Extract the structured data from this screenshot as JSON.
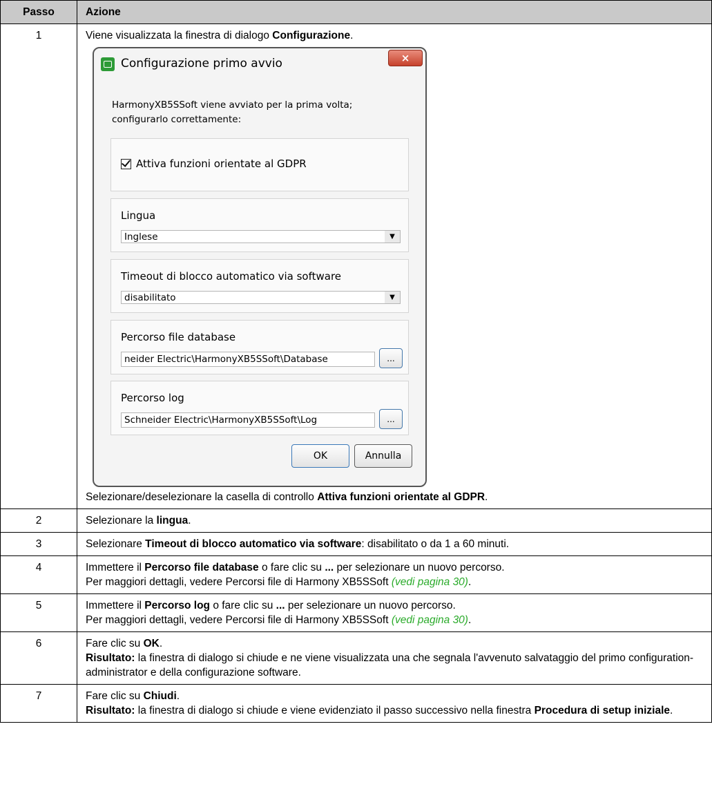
{
  "table": {
    "header_step": "Passo",
    "header_action": "Azione"
  },
  "step1": {
    "num": "1",
    "intro_pre": "Viene visualizzata la finestra di dialogo ",
    "intro_bold": "Configurazione",
    "intro_post": ".",
    "after_pre": "Selezionare/deselezionare la casella di controllo ",
    "after_bold": "Attiva funzioni orientate al GDPR",
    "after_post": "."
  },
  "dialog": {
    "title": "Configurazione primo avvio",
    "close_label": "×",
    "intro_line1": "HarmonyXB5SSoft viene avviato per la prima volta;",
    "intro_line2": "configurarlo correttamente:",
    "gdpr_label": "Attiva funzioni orientate al GDPR",
    "gdpr_checked": true,
    "language_label": "Lingua",
    "language_value": "Inglese",
    "timeout_label": "Timeout di blocco automatico via software",
    "timeout_value": "disabilitato",
    "db_path_label": "Percorso file database",
    "db_path_value": "neider Electric\\HarmonyXB5SSoft\\Database",
    "log_path_label": "Percorso log",
    "log_path_value": "Schneider Electric\\HarmonyXB5SSoft\\Log",
    "browse_label": "...",
    "ok_label": "OK",
    "cancel_label": "Annulla"
  },
  "step2": {
    "num": "2",
    "pre": "Selezionare la ",
    "bold": "lingua",
    "post": "."
  },
  "step3": {
    "num": "3",
    "pre": "Selezionare ",
    "bold": "Timeout di blocco automatico via software",
    "post": ": disabilitato o da 1 a 60 minuti."
  },
  "step4": {
    "num": "4",
    "pre": "Immettere il ",
    "bold": "Percorso file database",
    "mid": " o fare clic su ",
    "bold2": "...",
    "post": " per selezionare un nuovo percorso.",
    "line2": "Per maggiori dettagli, vedere Percorsi file di Harmony XB5SSoft ",
    "link": "(vedi pagina 30)",
    "end": "."
  },
  "step5": {
    "num": "5",
    "pre": "Immettere il ",
    "bold": "Percorso log",
    "mid": " o fare clic su ",
    "bold2": "...",
    "post": " per selezionare un nuovo percorso.",
    "line2": "Per maggiori dettagli, vedere Percorsi file di Harmony XB5SSoft ",
    "link": "(vedi pagina 30)",
    "end": "."
  },
  "step6": {
    "num": "6",
    "pre": "Fare clic su ",
    "bold": "OK",
    "post": ".",
    "result_label": "Risultato:",
    "result_text": " la finestra di dialogo si chiude e ne viene visualizzata una che segnala l'avvenuto salvataggio del primo configuration-administrator e della configurazione software."
  },
  "step7": {
    "num": "7",
    "pre": "Fare clic su ",
    "bold": "Chiudi",
    "post": ".",
    "result_label": "Risultato:",
    "result_text": " la finestra di dialogo si chiude e viene evidenziato il passo successivo nella finestra ",
    "result_bold": "Procedura di setup iniziale",
    "result_end": "."
  },
  "colors": {
    "header_bg": "#c9c9c9",
    "link": "#2bab2b",
    "app_icon": "#2d9b37",
    "close_button": "#c6422c"
  }
}
